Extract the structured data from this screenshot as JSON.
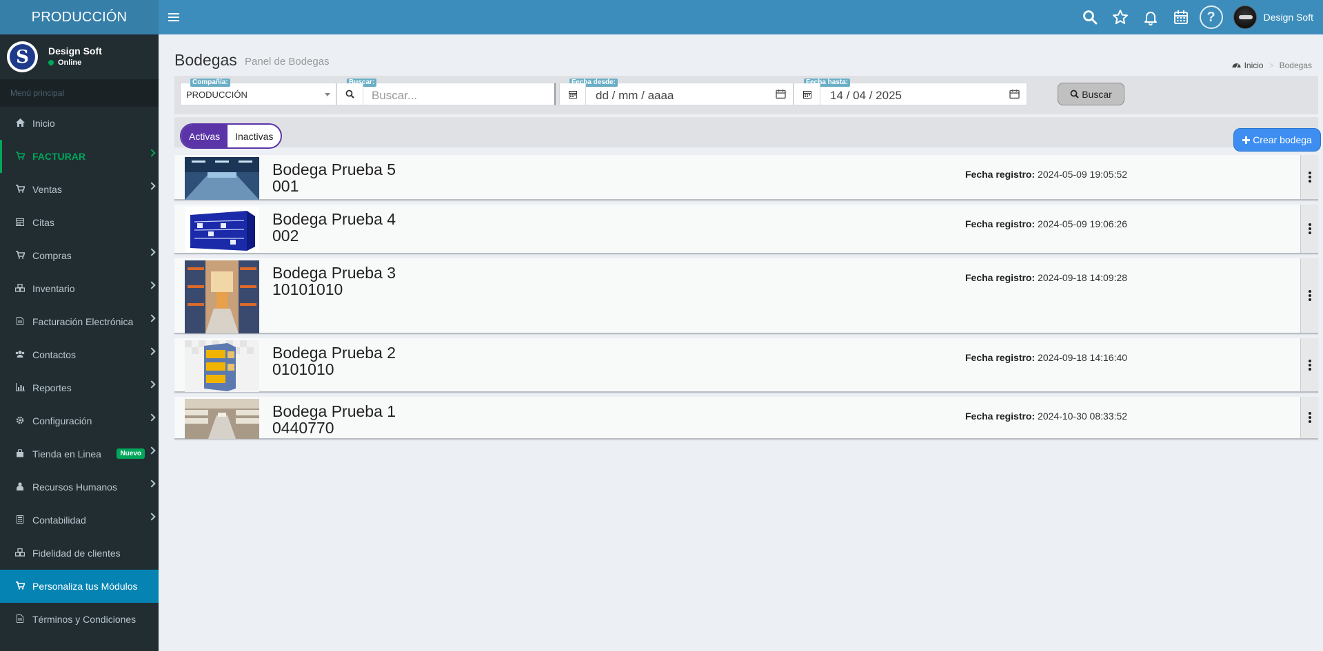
{
  "app": {
    "brand": "PRODUCCIÓN",
    "user_name": "Design Soft"
  },
  "sidebar": {
    "user_name": "Design Soft",
    "status": "Online",
    "header": "Menú principal",
    "items": [
      {
        "label": "Inicio",
        "icon": "home-icon"
      },
      {
        "label": "FACTURAR",
        "icon": "cart-icon"
      },
      {
        "label": "Ventas",
        "icon": "cart-icon"
      },
      {
        "label": "Citas",
        "icon": "calendar-icon"
      },
      {
        "label": "Compras",
        "icon": "cart-icon"
      },
      {
        "label": "Inventario",
        "icon": "cubes-icon"
      },
      {
        "label": "Facturación Electrónica",
        "icon": "file-icon"
      },
      {
        "label": "Contactos",
        "icon": "users-icon"
      },
      {
        "label": "Reportes",
        "icon": "bar-chart-icon"
      },
      {
        "label": "Configuración",
        "icon": "gear-icon"
      },
      {
        "label": "Tienda en Linea",
        "icon": "shopping-bag-icon",
        "badge": "Nuevo"
      },
      {
        "label": "Recursos Humanos",
        "icon": "person-icon"
      },
      {
        "label": "Contabilidad",
        "icon": "calculator-icon"
      },
      {
        "label": "Fidelidad de clientes",
        "icon": "cubes-icon"
      },
      {
        "label": "Personaliza tus Módulos",
        "icon": "cart-icon"
      },
      {
        "label": "Términos y Condiciones",
        "icon": "file-icon"
      }
    ]
  },
  "page": {
    "title": "Bodegas",
    "subtitle": "Panel de Bodegas",
    "breadcrumb_home": "Inicio",
    "breadcrumb_current": "Bodegas"
  },
  "filters": {
    "company_label": "Compañía:",
    "company_value": "PRODUCCIÓN",
    "search_label": "Buscar:",
    "search_placeholder": "Buscar...",
    "date_from_label": "Fecha desde:",
    "date_from_value": "dd / mm / aaaa",
    "date_to_label": "Fecha hasta:",
    "date_to_value": "14 / 04 / 2025",
    "search_button": "Buscar"
  },
  "tabs": {
    "active": "Activas",
    "inactive": "Inactivas"
  },
  "create_button": "Crear bodega",
  "date_label": "Fecha registro:",
  "warehouses": [
    {
      "name": "Bodega Prueba 5",
      "code": "001",
      "date": "2024-05-09 19:05:52"
    },
    {
      "name": "Bodega Prueba 4",
      "code": "002",
      "date": "2024-05-09 19:06:26"
    },
    {
      "name": "Bodega Prueba 3",
      "code": "10101010",
      "date": "2024-09-18 14:09:28"
    },
    {
      "name": "Bodega Prueba 2",
      "code": "0101010",
      "date": "2024-09-18 14:16:40"
    },
    {
      "name": "Bodega Prueba 1",
      "code": "0440770",
      "date": "2024-10-30 08:33:52"
    }
  ]
}
